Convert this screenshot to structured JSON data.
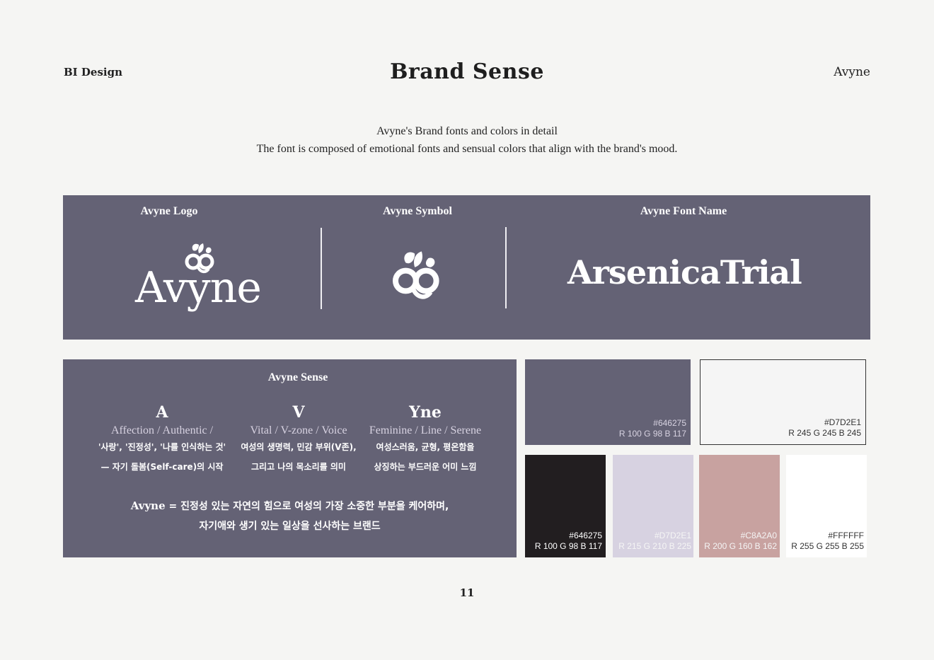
{
  "header": {
    "left": "BI Design",
    "title": "Brand Sense",
    "right": "Avyne"
  },
  "intro": {
    "line1": "Avyne's Brand fonts and colors in detail",
    "line2": "The font is composed of emotional fonts and sensual colors that align with the brand's mood."
  },
  "top_panel": {
    "logo_label": "Avyne Logo",
    "logo_word": "Avyne",
    "symbol_label": "Avyne Symbol",
    "font_label": "Avyne Font Name",
    "font_name": "ArsenicaTrial"
  },
  "sense": {
    "title": "Avyne Sense",
    "columns": [
      {
        "letter": "A",
        "english": "Affection / Authentic /",
        "korean1": "'사랑', '진정성', '나를 인식하는 것'",
        "korean2": "— 자기 돌봄(Self-care)의 시작"
      },
      {
        "letter": "V",
        "english": "Vital / V-zone / Voice",
        "korean1": "여성의 생명력, 민감 부위(V존),",
        "korean2": "그리고 나의 목소리를 의미"
      },
      {
        "letter": "Yne",
        "english": "Feminine / Line / Serene",
        "korean1": "여성스러움, 균형, 평온함을",
        "korean2": "상징하는 부드러운 어미 느낌"
      }
    ],
    "statement_brand": "Avyne",
    "statement_line1": " = 진정성 있는 자연의 힘으로 여성의 가장 소중한 부분을 케어하며,",
    "statement_line2": "자기애와 생기 있는 일상을 선사하는 브랜드"
  },
  "colors": {
    "primary": "#646275",
    "background": "#f5f5f3",
    "swatches": [
      {
        "hex": "#646275",
        "rgb": "R 100 G 98 B 117",
        "fill": "#646275",
        "text_color": "#d7d2e1"
      },
      {
        "hex": "#D7D2E1",
        "rgb": "R 245 G 245 B 245",
        "fill": "#f5f5f5",
        "text_color": "#333333"
      },
      {
        "hex": "#646275",
        "rgb": "R 100 G 98 B 117",
        "fill": "#221e20",
        "text_color": "#ffffff"
      },
      {
        "hex": "#D7D2E1",
        "rgb": "R 215 G 210 B 225",
        "fill": "#d7d2e1",
        "text_color": "#f5f5f5"
      },
      {
        "hex": "#C8A2A0",
        "rgb": "R 200 G 160 B 162",
        "fill": "#c8a2a0",
        "text_color": "#f5f5f5"
      },
      {
        "hex": "#FFFFFF",
        "rgb": "R 255 G 255 B 255",
        "fill": "#ffffff",
        "text_color": "#333333"
      }
    ]
  },
  "page_number": "11",
  "icons": {
    "logo_symbol": "leaf-knot-icon"
  }
}
